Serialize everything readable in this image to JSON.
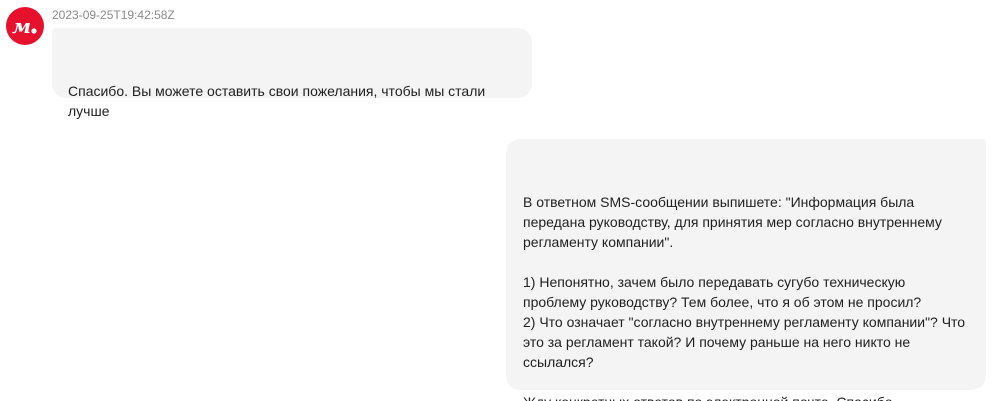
{
  "brand": {
    "logo_icon": "m-dot-logo-icon",
    "logo_color": "#e8112d"
  },
  "messages": [
    {
      "direction": "incoming",
      "timestamp": "2023-09-25T19:42:58Z",
      "text": "Спасибо. Вы можете оставить свои пожелания, чтобы мы стали\nлучше"
    },
    {
      "direction": "outgoing",
      "text": "В ответном SMS-сообщении выпишете: \"Информация была\nпередана руководству, для принятия мер согласно внутреннему\nрегламенту компании\".\n\n1) Непонятно, зачем было передавать сугубо техническую\nпроблему руководству? Тем более, что я об этом не просил?\n2) Что означает \"согласно внутреннему регламенту компании\"? Что\nэто за регламент такой? И почему раньше на него никто не\nссылался?\n\nЖду конкретных ответов по электронной почте. Спасибо."
    }
  ],
  "colors": {
    "bubble_background": "#f4f4f4",
    "timestamp_text": "#8a8a8a"
  }
}
